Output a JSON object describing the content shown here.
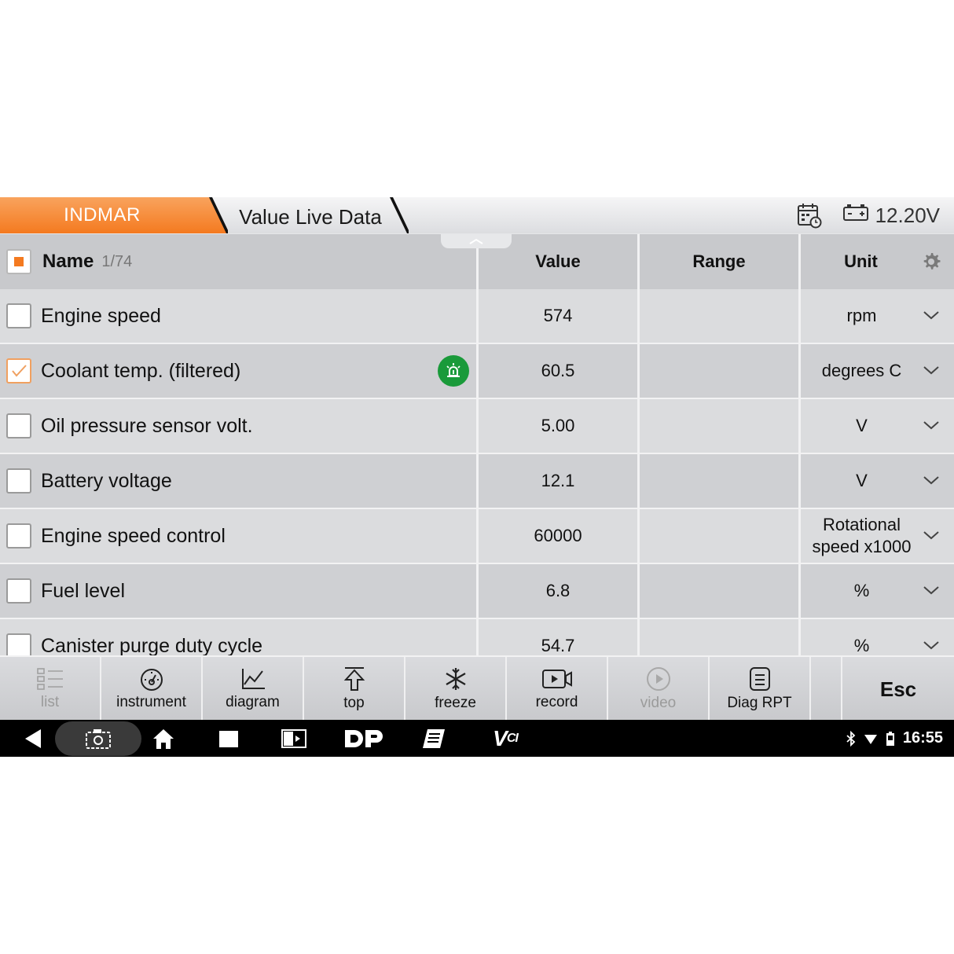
{
  "header": {
    "brand_tab": "INDMAR",
    "title_tab": "Value Live Data",
    "voltage": "12.20V",
    "icons": {
      "calendar": "calendar-clock-icon",
      "battery": "battery-icon"
    }
  },
  "table": {
    "columns": {
      "name": "Name",
      "value": "Value",
      "range": "Range",
      "unit": "Unit"
    },
    "count": "1/74",
    "rows": [
      {
        "name": "Engine speed",
        "value": "574",
        "range": "",
        "unit": "rpm",
        "checked": false
      },
      {
        "name": "Coolant temp. (filtered)",
        "value": "60.5",
        "range": "",
        "unit": "degrees C",
        "checked": true,
        "alarm": true
      },
      {
        "name": "Oil pressure sensor volt.",
        "value": "5.00",
        "range": "",
        "unit": "V",
        "checked": false
      },
      {
        "name": "Battery voltage",
        "value": "12.1",
        "range": "",
        "unit": "V",
        "checked": false
      },
      {
        "name": "Engine speed control",
        "value": "60000",
        "range": "",
        "unit_line1": "Rotational",
        "unit_line2": "speed x1000",
        "checked": false
      },
      {
        "name": "Fuel level",
        "value": "6.8",
        "range": "",
        "unit": "%",
        "checked": false
      },
      {
        "name": "Canister purge duty cycle",
        "value": "54.7",
        "range": "",
        "unit": "%",
        "checked": false
      }
    ]
  },
  "toolbar": {
    "list": "list",
    "instrument": "instrument",
    "diagram": "diagram",
    "top": "top",
    "freeze": "freeze",
    "record": "record",
    "video": "video",
    "diag_rpt": "Diag RPT",
    "esc": "Esc"
  },
  "navbar": {
    "time": "16:55",
    "dp_label": "DP",
    "vci_label": "V",
    "vci_sub": "CI"
  },
  "colors": {
    "accent": "#f47a20",
    "alarm": "#1a9a3a"
  }
}
